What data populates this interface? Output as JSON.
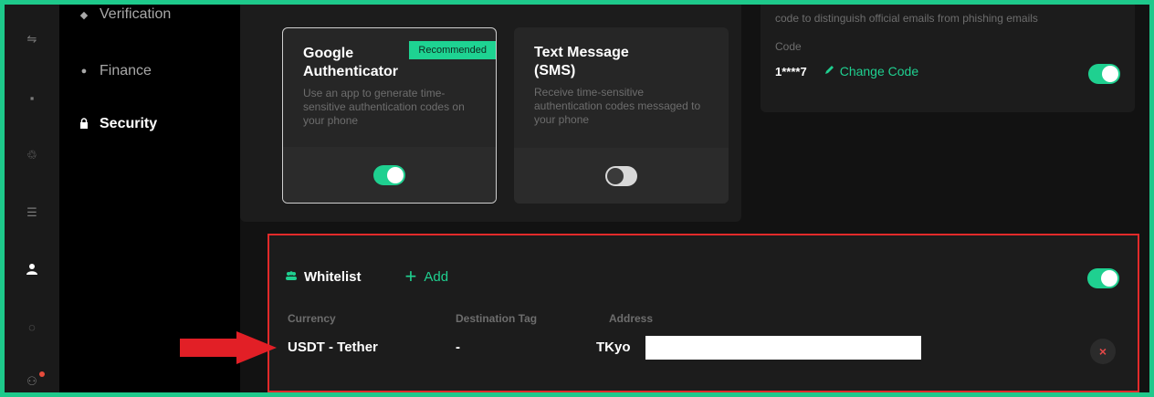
{
  "subnav": {
    "items": [
      {
        "label": "Verification",
        "icon": "shield-check-icon"
      },
      {
        "label": "Finance",
        "icon": "info-dot-icon"
      },
      {
        "label": "Security",
        "icon": "lock-icon"
      }
    ]
  },
  "twofa": {
    "google": {
      "title": "Google Authenticator",
      "badge": "Recommended",
      "description": "Use an app to generate time-sensitive authentication codes on your phone",
      "enabled": true
    },
    "sms": {
      "title": "Text Message (SMS)",
      "description": "Receive time-sensitive authentication codes messaged to your phone",
      "enabled": false
    }
  },
  "anti_phishing": {
    "description": "code to distinguish official emails from phishing emails",
    "code_label": "Code",
    "code_value": "1****7",
    "change_label": "Change Code",
    "enabled": true
  },
  "whitelist": {
    "title": "Whitelist",
    "add_label": "Add",
    "enabled": true,
    "columns": {
      "currency": "Currency",
      "destination_tag": "Destination Tag",
      "address": "Address"
    },
    "rows": [
      {
        "currency": "USDT - Tether",
        "destination_tag": "-",
        "address": "TKyo"
      }
    ],
    "remove_label": "×"
  },
  "colors": {
    "accent": "#1fd090",
    "highlight_border": "#e12a2a",
    "frame": "#1ec98b"
  }
}
